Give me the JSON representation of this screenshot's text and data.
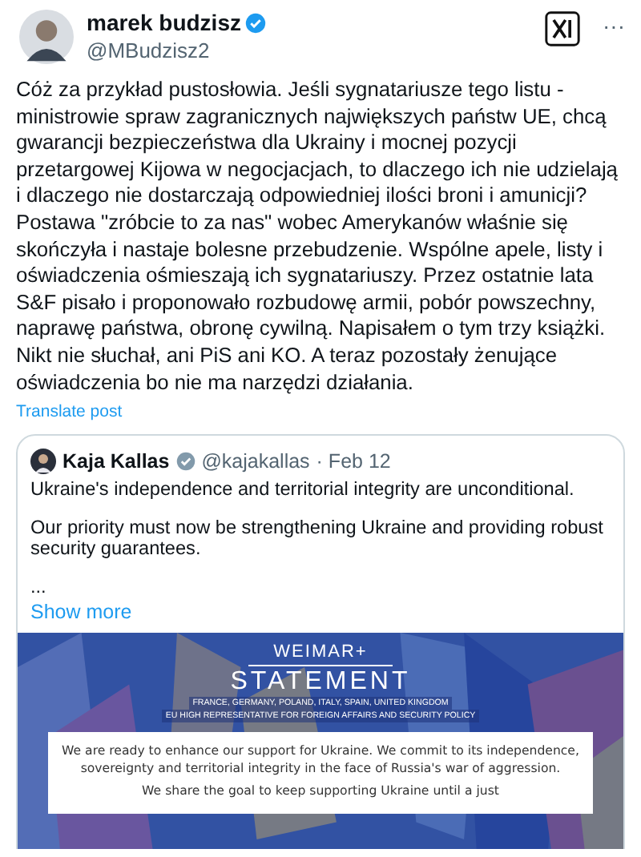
{
  "post": {
    "author": "marek budzisz",
    "verified": true,
    "handle": "@MBudzisz2",
    "more": "···",
    "text": "Cóż za przykład pustosłowia. Jeśli sygnatariusze tego listu - ministrowie spraw zagranicznych największych państw UE, chcą gwarancji bezpieczeństwa dla Ukrainy i mocnej pozycji przetargowej Kijowa w negocjacjach, to dlaczego ich nie udzielają i dlaczego nie dostarczają odpowiedniej ilości broni i amunicji? Postawa \"zróbcie to za nas\" wobec Amerykanów właśnie się skończyła i nastaje bolesne przebudzenie. Wspólne apele, listy i oświadczenia ośmieszają ich sygnatariuszy. Przez ostatnie lata S&F pisało i proponowało rozbudowę armii, pobór powszechny, naprawę państwa, obronę cywilną. Napisałem o tym trzy książki. Nikt nie słuchał, ani PiS ani KO. A teraz pozostały żenujące oświadczenia bo nie ma narzędzi działania.",
    "translate": "Translate post"
  },
  "quote": {
    "author": "Kaja Kallas",
    "verified": true,
    "handle": "@kajakallas",
    "date": "· Feb 12",
    "paragraphs": [
      "Ukraine's independence and territorial integrity are unconditional.",
      "Our priority must now be strengthening Ukraine and providing robust security guarantees.",
      "..."
    ],
    "show_more": "Show more",
    "image": {
      "kicker": "WEIMAR+",
      "title": "STATEMENT",
      "subtitle_lines": [
        "FRANCE, GERMANY, POLAND, ITALY, SPAIN, UNITED KINGDOM",
        "EU HIGH REPRESENTATIVE FOR FOREIGN AFFAIRS AND SECURITY POLICY"
      ],
      "paragraphs": [
        "We are ready to enhance our support for Ukraine. We commit to its independence, sovereignty and territorial integrity in the face of Russia's war of aggression.",
        "We share the goal to keep supporting Ukraine until a just"
      ]
    }
  }
}
